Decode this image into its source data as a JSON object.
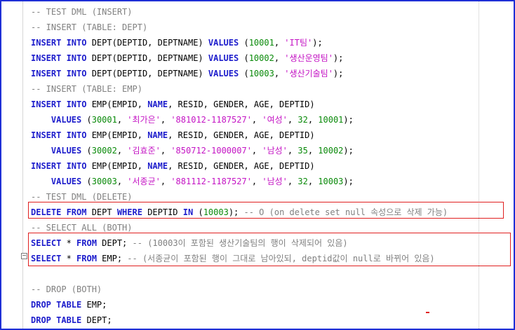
{
  "lines": [
    [
      [
        "cm",
        "-- TEST DML (INSERT)"
      ]
    ],
    [
      [
        "cm",
        "-- INSERT (TABLE: DEPT)"
      ]
    ],
    [
      [
        "kw",
        "INSERT INTO "
      ],
      [
        "id",
        "DEPT(DEPTID, DEPTNAME) "
      ],
      [
        "kw",
        "VALUES "
      ],
      [
        "id",
        "("
      ],
      [
        "num",
        "10001"
      ],
      [
        "id",
        ", "
      ],
      [
        "str",
        "'IT팀'"
      ],
      [
        "id",
        ");"
      ]
    ],
    [
      [
        "kw",
        "INSERT INTO "
      ],
      [
        "id",
        "DEPT(DEPTID, DEPTNAME) "
      ],
      [
        "kw",
        "VALUES "
      ],
      [
        "id",
        "("
      ],
      [
        "num",
        "10002"
      ],
      [
        "id",
        ", "
      ],
      [
        "str",
        "'생산운영팀'"
      ],
      [
        "id",
        ");"
      ]
    ],
    [
      [
        "kw",
        "INSERT INTO "
      ],
      [
        "id",
        "DEPT(DEPTID, DEPTNAME) "
      ],
      [
        "kw",
        "VALUES "
      ],
      [
        "id",
        "("
      ],
      [
        "num",
        "10003"
      ],
      [
        "id",
        ", "
      ],
      [
        "str",
        "'생산기술팀'"
      ],
      [
        "id",
        ");"
      ]
    ],
    [
      [
        "cm",
        "-- INSERT (TABLE: EMP)"
      ]
    ],
    [
      [
        "kw",
        "INSERT INTO "
      ],
      [
        "id",
        "EMP(EMPID, "
      ],
      [
        "kw",
        "NAME"
      ],
      [
        "id",
        ", RESID, GENDER, AGE, DEPTID)"
      ]
    ],
    [
      [
        "id",
        "    "
      ],
      [
        "kw",
        "VALUES "
      ],
      [
        "id",
        "("
      ],
      [
        "num",
        "30001"
      ],
      [
        "id",
        ", "
      ],
      [
        "str",
        "'최가은'"
      ],
      [
        "id",
        ", "
      ],
      [
        "str",
        "'881012-1187527'"
      ],
      [
        "id",
        ", "
      ],
      [
        "str",
        "'여성'"
      ],
      [
        "id",
        ", "
      ],
      [
        "num",
        "32"
      ],
      [
        "id",
        ", "
      ],
      [
        "num",
        "10001"
      ],
      [
        "id",
        ");"
      ]
    ],
    [
      [
        "kw",
        "INSERT INTO "
      ],
      [
        "id",
        "EMP(EMPID, "
      ],
      [
        "kw",
        "NAME"
      ],
      [
        "id",
        ", RESID, GENDER, AGE, DEPTID)"
      ]
    ],
    [
      [
        "id",
        "    "
      ],
      [
        "kw",
        "VALUES "
      ],
      [
        "id",
        "("
      ],
      [
        "num",
        "30002"
      ],
      [
        "id",
        ", "
      ],
      [
        "str",
        "'김효준'"
      ],
      [
        "id",
        ", "
      ],
      [
        "str",
        "'850712-1000007'"
      ],
      [
        "id",
        ", "
      ],
      [
        "str",
        "'남성'"
      ],
      [
        "id",
        ", "
      ],
      [
        "num",
        "35"
      ],
      [
        "id",
        ", "
      ],
      [
        "num",
        "10002"
      ],
      [
        "id",
        ");"
      ]
    ],
    [
      [
        "kw",
        "INSERT INTO "
      ],
      [
        "id",
        "EMP(EMPID, "
      ],
      [
        "kw",
        "NAME"
      ],
      [
        "id",
        ", RESID, GENDER, AGE, DEPTID)"
      ]
    ],
    [
      [
        "id",
        "    "
      ],
      [
        "kw",
        "VALUES "
      ],
      [
        "id",
        "("
      ],
      [
        "num",
        "30003"
      ],
      [
        "id",
        ", "
      ],
      [
        "str",
        "'서종균'"
      ],
      [
        "id",
        ", "
      ],
      [
        "str",
        "'881112-1187527'"
      ],
      [
        "id",
        ", "
      ],
      [
        "str",
        "'남성'"
      ],
      [
        "id",
        ", "
      ],
      [
        "num",
        "32"
      ],
      [
        "id",
        ", "
      ],
      [
        "num",
        "10003"
      ],
      [
        "id",
        ");"
      ]
    ],
    [
      [
        "cm",
        "-- TEST DML (DELETE)"
      ]
    ],
    [
      [
        "kw",
        "DELETE FROM "
      ],
      [
        "id",
        "DEPT "
      ],
      [
        "kw",
        "WHERE "
      ],
      [
        "id",
        "DEPTID "
      ],
      [
        "kw",
        "IN "
      ],
      [
        "id",
        "("
      ],
      [
        "num",
        "10003"
      ],
      [
        "id",
        "); "
      ],
      [
        "cm",
        "-- O (on delete set null 속성으로 삭제 가능)"
      ]
    ],
    [
      [
        "cm",
        "-- SELECT ALL (BOTH)"
      ]
    ],
    [
      [
        "kw",
        "SELECT "
      ],
      [
        "id",
        "* "
      ],
      [
        "kw",
        "FROM "
      ],
      [
        "id",
        "DEPT; "
      ],
      [
        "cm",
        "-- (10003이 포함된 생산기술팀의 행이 삭제되어 있음)"
      ]
    ],
    [
      [
        "kw",
        "SELECT "
      ],
      [
        "id",
        "* "
      ],
      [
        "kw",
        "FROM "
      ],
      [
        "id",
        "EMP; "
      ],
      [
        "cm",
        "-- (서종균이 포함된 행이 그대로 남아있되, deptid값이 null로 바뀌어 있음)"
      ]
    ],
    [
      [
        "id",
        ""
      ]
    ],
    [
      [
        "cm",
        "-- DROP (BOTH)"
      ]
    ],
    [
      [
        "kw",
        "DROP TABLE "
      ],
      [
        "id",
        "EMP;"
      ]
    ],
    [
      [
        "kw",
        "DROP TABLE "
      ],
      [
        "id",
        "DEPT;"
      ]
    ]
  ],
  "colors": {
    "keyword": "#1d1dcc",
    "comment": "#808080",
    "number": "#0a8a0a",
    "string": "#c414c4",
    "highlight_box": "#e02020",
    "window_border": "#1e2fd6"
  },
  "icons": {
    "fold_marker": "collapse-minus-icon"
  }
}
